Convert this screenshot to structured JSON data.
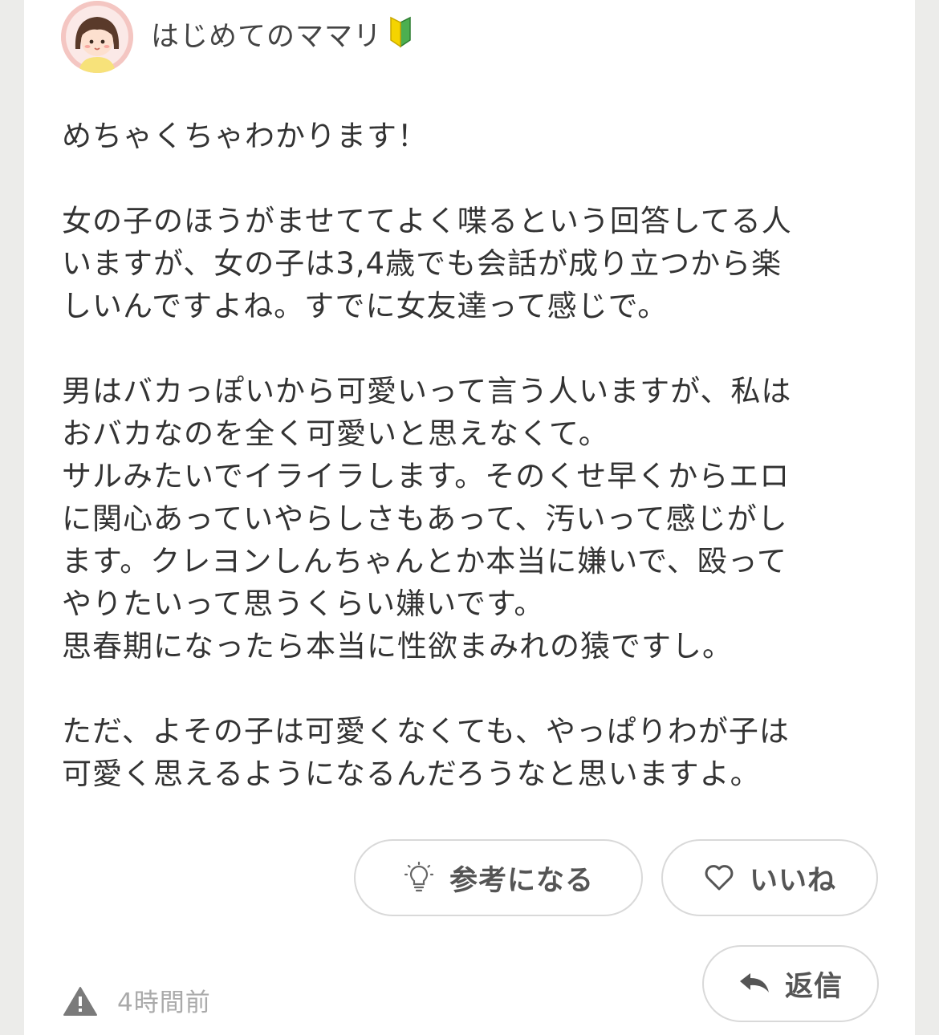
{
  "colors": {
    "background": "#ececea",
    "card": "#ffffff",
    "text": "#333333",
    "muted": "#aaaaaa",
    "pill_border": "#d9d9d9",
    "avatar_bg": "#f4c6c2",
    "beginner_green": "#4caf50",
    "beginner_yellow": "#f5d400"
  },
  "post": {
    "author": {
      "username": "はじめてのママリ",
      "avatar_icon": "girl-avatar-icon",
      "badge_icon": "beginner-mark-icon"
    },
    "body": {
      "p1": "めちゃくちゃわかります！",
      "p2_l1": "女の子のほうがませててよく喋るという回答してる人",
      "p2_l2": "いますが、女の子は3,4歳でも会話が成り立つから楽",
      "p2_l3": "しいんですよね。すでに女友達って感じで。",
      "p3_l1": "男はバカっぽいから可愛いって言う人いますが、私は",
      "p3_l2": "おバカなのを全く可愛いと思えなくて。",
      "p3_l3": "サルみたいでイライラします。そのくせ早くからエロ",
      "p3_l4": "に関心あっていやらしさもあって、汚いって感じがし",
      "p3_l5": "ます。クレヨンしんちゃんとか本当に嫌いで、殴って",
      "p3_l6": "やりたいって思うくらい嫌いです。",
      "p3_l7": "思春期になったら本当に性欲まみれの猿ですし。",
      "p4_l1": "ただ、よその子は可愛くなくても、やっぱりわが子は",
      "p4_l2": "可愛く思えるようになるんだろうなと思いますよ。"
    },
    "actions": {
      "helpful_label": "参考になる",
      "helpful_icon": "lightbulb-icon",
      "like_label": "いいね",
      "like_icon": "heart-icon",
      "reply_label": "返信",
      "reply_icon": "reply-arrow-icon"
    },
    "footer": {
      "report_icon": "warning-icon",
      "timestamp": "4時間前"
    }
  }
}
